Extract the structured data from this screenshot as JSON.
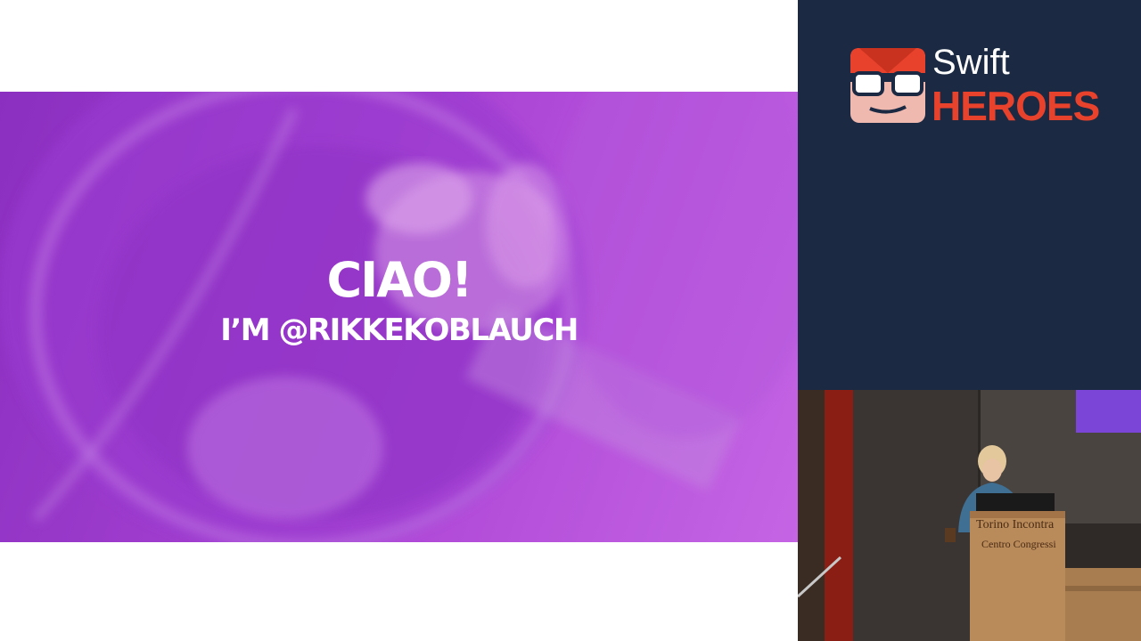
{
  "slide": {
    "title": "CIAO!",
    "subtitle": "I’M @RIKKEKOBLAUCH",
    "background_color": "#a23fd0"
  },
  "sidebar": {
    "background_color": "#1b2a42",
    "logo": {
      "word1": "Swift",
      "word2": "HEROES",
      "accent_color": "#e8412c",
      "mascot_icon": "hero-mascot-icon"
    }
  },
  "video": {
    "podium_text_line1": "Torino Incontra",
    "podium_text_line2": "Centro Congressi"
  }
}
